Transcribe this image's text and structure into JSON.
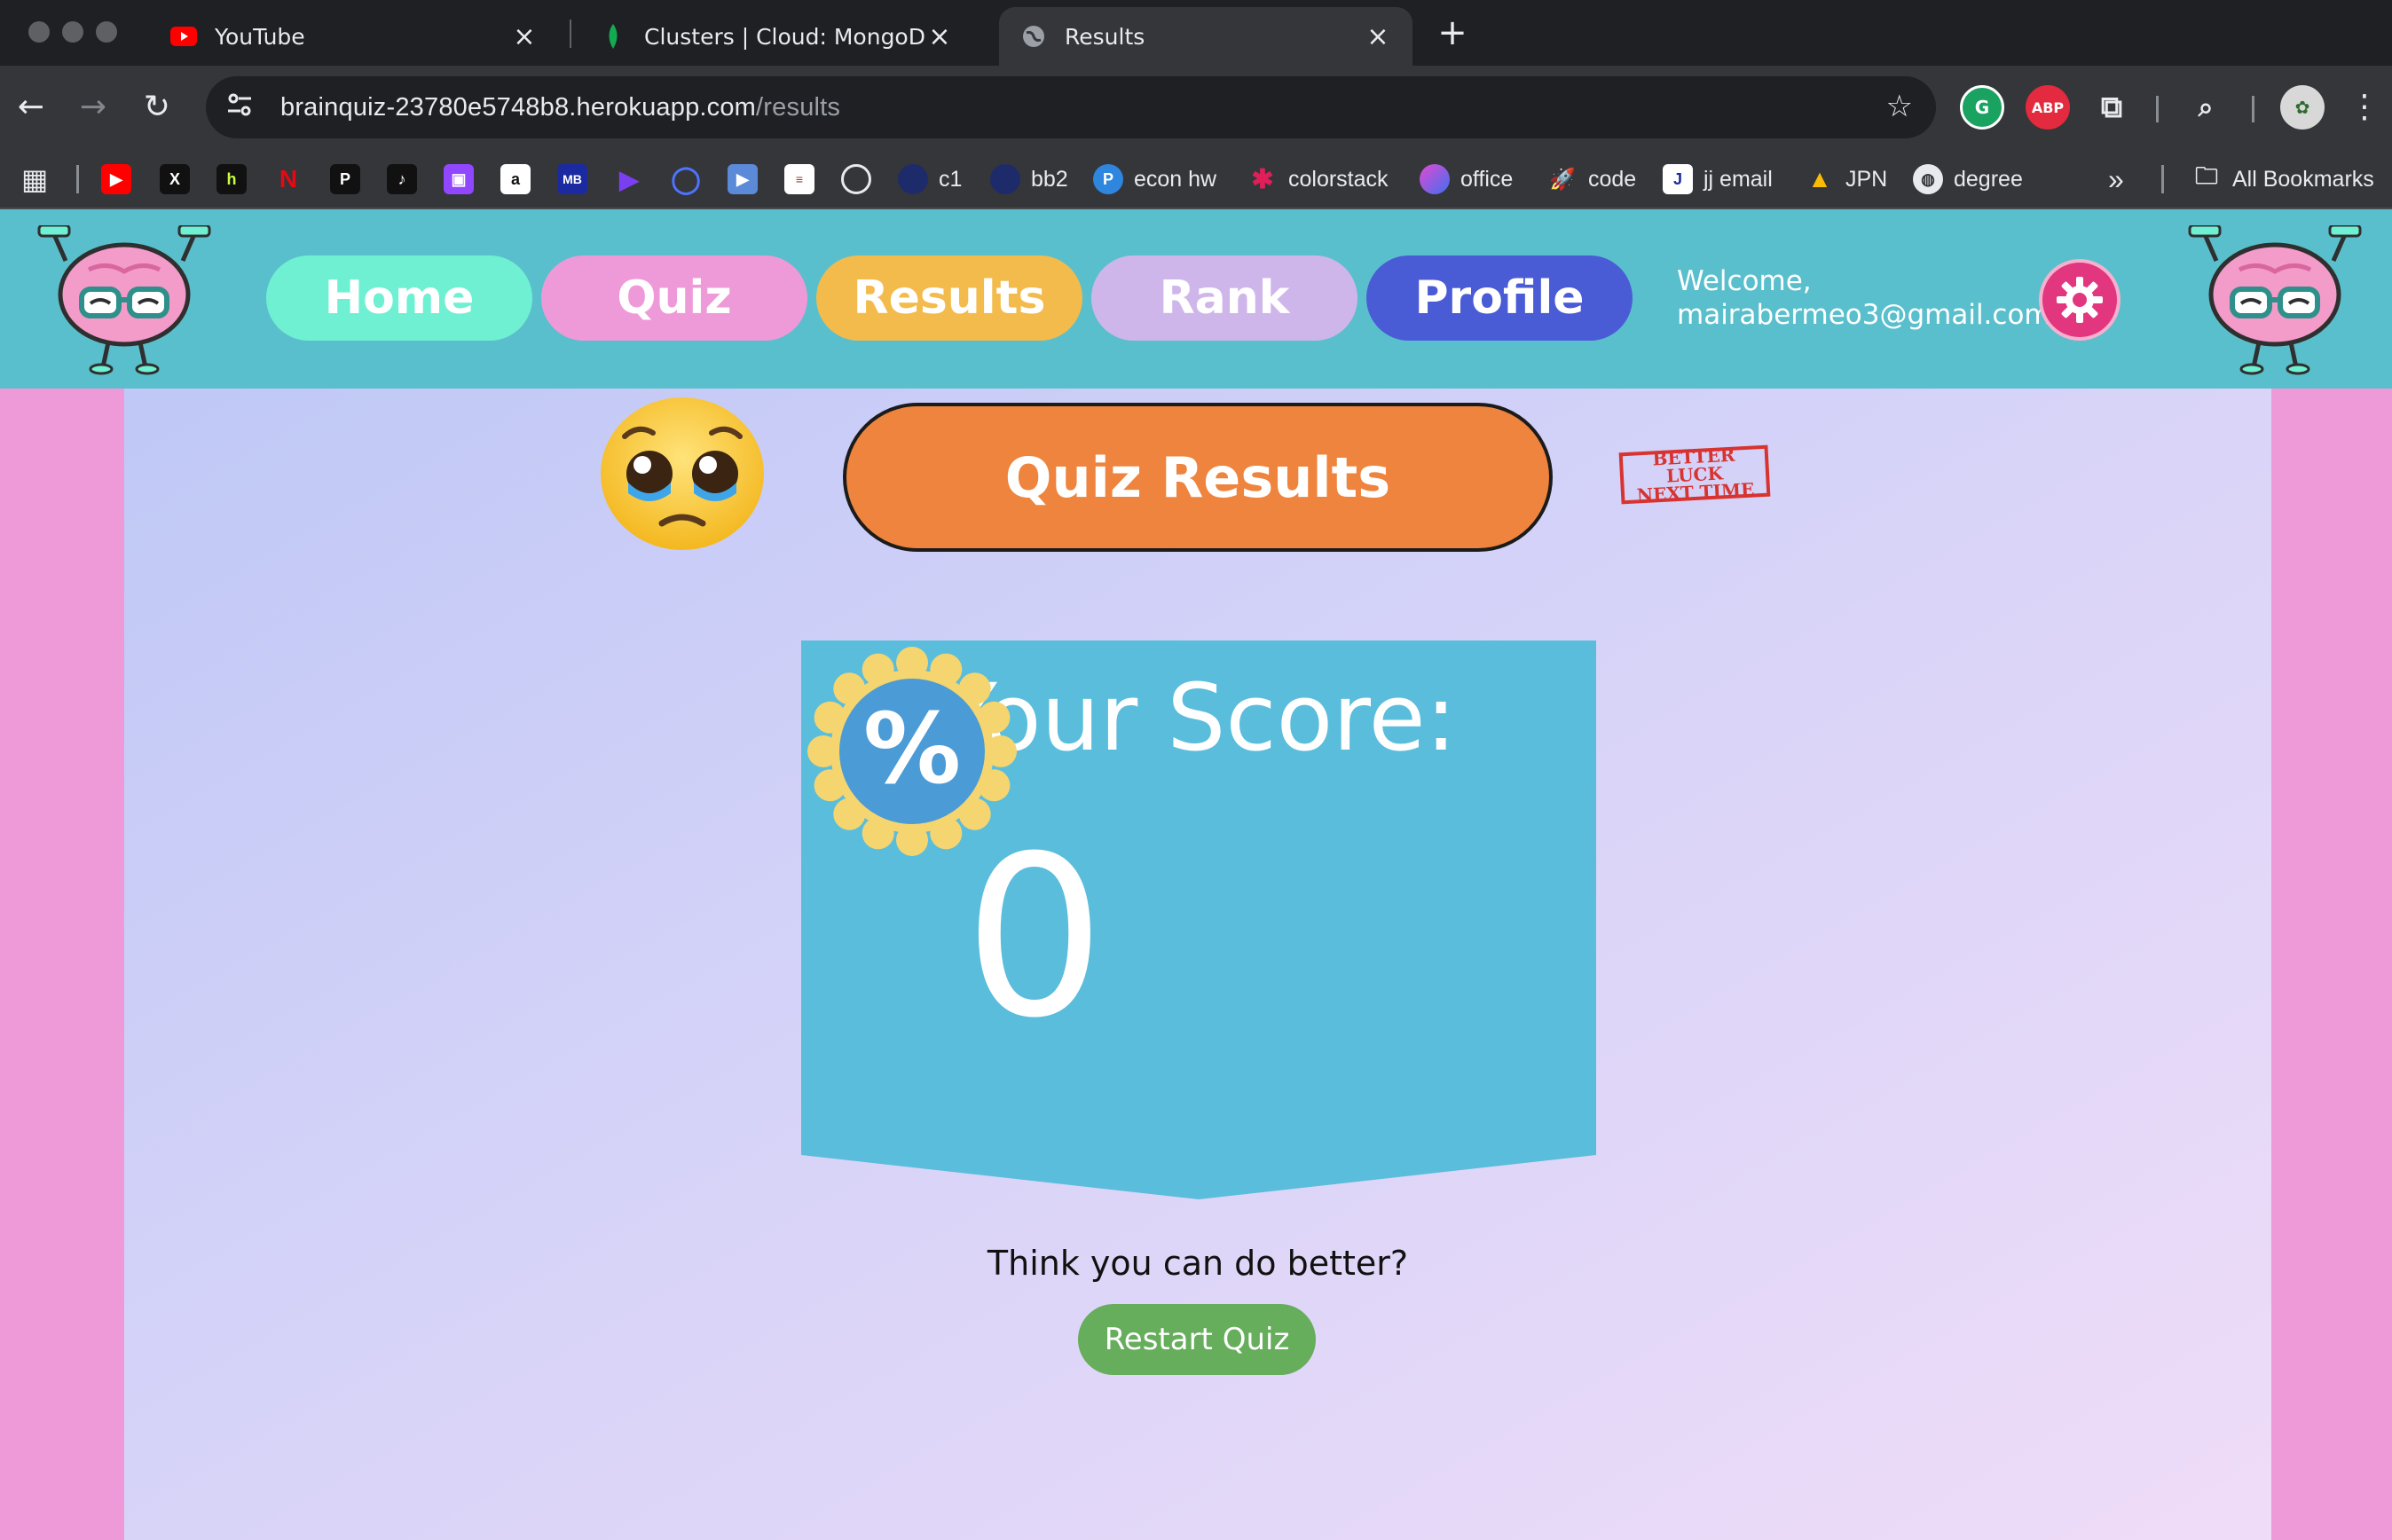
{
  "browser": {
    "tabs": [
      {
        "title": "YouTube",
        "icon": "youtube-icon",
        "active": false
      },
      {
        "title": "Clusters | Cloud: MongoDB Cl",
        "icon": "mongodb-leaf-icon",
        "active": false
      },
      {
        "title": "Results",
        "icon": "globe-icon",
        "active": true
      }
    ],
    "url_host": "brainquiz-23780e5748b8.herokuapp.com",
    "url_path": "/results",
    "extensions": {
      "abp_label": "ABP"
    },
    "bookmarks": [
      {
        "label": "c1",
        "icon": "bookmark-c1-icon"
      },
      {
        "label": "bb2",
        "icon": "bookmark-bb2-icon"
      },
      {
        "label": "econ hw",
        "icon": "bookmark-econ-icon"
      },
      {
        "label": "colorstack",
        "icon": "slack-icon"
      },
      {
        "label": "office",
        "icon": "office-icon"
      },
      {
        "label": "code",
        "icon": "rocket-icon"
      },
      {
        "label": "jj email",
        "icon": "jj-icon"
      },
      {
        "label": "JPN",
        "icon": "drive-icon"
      },
      {
        "label": "degree",
        "icon": "globe-icon"
      }
    ],
    "all_bookmarks_label": "All Bookmarks"
  },
  "nav": {
    "items": [
      {
        "label": "Home",
        "color": "#6ff0d2"
      },
      {
        "label": "Quiz",
        "color": "#ef9ad8"
      },
      {
        "label": "Results",
        "color": "#f3bb4c"
      },
      {
        "label": "Rank",
        "color": "#cfb6ea"
      },
      {
        "label": "Profile",
        "color": "#4a5bd6"
      }
    ],
    "welcome_line1": "Welcome,",
    "welcome_email": "mairabermeo3@gmail.com"
  },
  "results": {
    "title": "Quiz Results",
    "stamp_line1": "BETTER LUCK",
    "stamp_line2": "NEXT TIME",
    "score_label": "Your Score:",
    "score_value": "0",
    "badge_symbol": "%",
    "prompt": "Think you can do better?",
    "restart_label": "Restart Quiz"
  },
  "colors": {
    "header_bg": "#5abfcc",
    "side_bg": "#ef9ad8",
    "title_orange": "#ee843e",
    "banner_blue": "#5abddc",
    "badge_gold": "#f4d56f",
    "badge_blue": "#4a9bd6",
    "restart_green": "#66ad5c"
  }
}
